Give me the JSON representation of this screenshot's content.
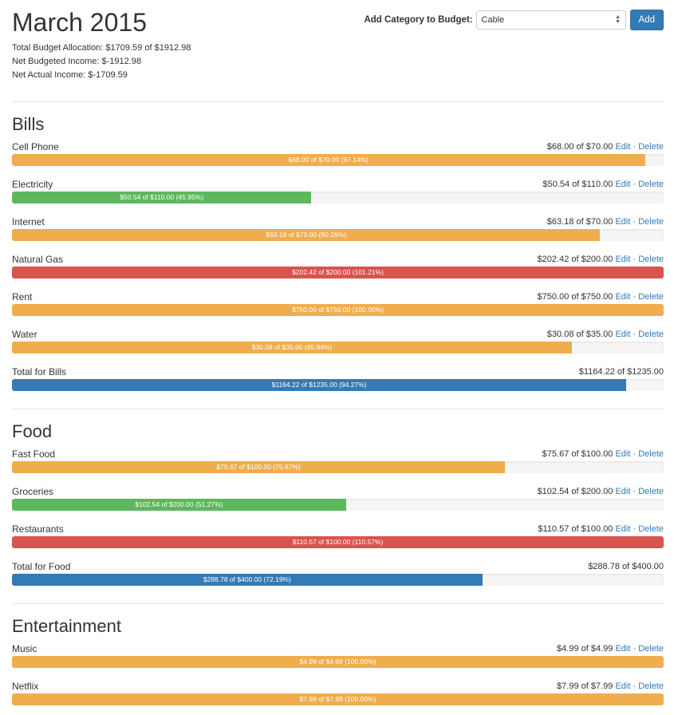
{
  "page_title": "March 2015",
  "summary": {
    "allocation": "Total Budget Allocation: $1709.59 of $1912.98",
    "budgeted_income": "Net Budgeted Income: $-1912.98",
    "actual_income": "Net Actual Income: $-1709.59"
  },
  "add_category": {
    "label": "Add Category to Budget:",
    "selected": "Cable",
    "button": "Add"
  },
  "link_labels": {
    "edit": "Edit",
    "delete": "Delete",
    "separator": "·"
  },
  "colors": {
    "warning": "#f0ad4e",
    "success": "#5cb85c",
    "danger": "#d9534f",
    "total": "#337ab7",
    "link": "#337ab7"
  },
  "sections": [
    {
      "title": "Bills",
      "rows": [
        {
          "name": "Cell Phone",
          "amount": "$68.00 of $70.00",
          "bar": "$68.00 of $70.00 (97.14%)",
          "percent": 97.14,
          "status": "warning"
        },
        {
          "name": "Electricity",
          "amount": "$50.54 of $110.00",
          "bar": "$50.54 of $110.00 (45.95%)",
          "percent": 45.95,
          "status": "success"
        },
        {
          "name": "Internet",
          "amount": "$63.18 of $70.00",
          "bar": "$63.18 of $70.00 (90.26%)",
          "percent": 90.26,
          "status": "warning"
        },
        {
          "name": "Natural Gas",
          "amount": "$202.42 of $200.00",
          "bar": "$202.42 of $200.00 (101.21%)",
          "percent": 101.21,
          "status": "danger"
        },
        {
          "name": "Rent",
          "amount": "$750.00 of $750.00",
          "bar": "$750.00 of $750.00 (100.00%)",
          "percent": 100.0,
          "status": "warning"
        },
        {
          "name": "Water",
          "amount": "$30.08 of $35.00",
          "bar": "$30.08 of $35.00 (85.94%)",
          "percent": 85.94,
          "status": "warning"
        }
      ],
      "total": {
        "name": "Total for Bills",
        "amount": "$1164.22 of $1235.00",
        "bar": "$1164.22 of $1235.00 (94.27%)",
        "percent": 94.27
      }
    },
    {
      "title": "Food",
      "rows": [
        {
          "name": "Fast Food",
          "amount": "$75.67 of $100.00",
          "bar": "$75.67 of $100.00 (75.67%)",
          "percent": 75.67,
          "status": "warning"
        },
        {
          "name": "Groceries",
          "amount": "$102.54 of $200.00",
          "bar": "$102.54 of $200.00 (51.27%)",
          "percent": 51.27,
          "status": "success"
        },
        {
          "name": "Restaurants",
          "amount": "$110.57 of $100.00",
          "bar": "$110.57 of $100.00 (110.57%)",
          "percent": 110.57,
          "status": "danger"
        }
      ],
      "total": {
        "name": "Total for Food",
        "amount": "$288.78 of $400.00",
        "bar": "$288.78 of $400.00 (72.19%)",
        "percent": 72.19
      }
    },
    {
      "title": "Entertainment",
      "rows": [
        {
          "name": "Music",
          "amount": "$4.99 of $4.99",
          "bar": "$4.99 of $4.99 (100.00%)",
          "percent": 100.0,
          "status": "warning"
        },
        {
          "name": "Netflix",
          "amount": "$7.99 of $7.99",
          "bar": "$7.99 of $7.99 (100.00%)",
          "percent": 100.0,
          "status": "warning"
        }
      ]
    }
  ]
}
